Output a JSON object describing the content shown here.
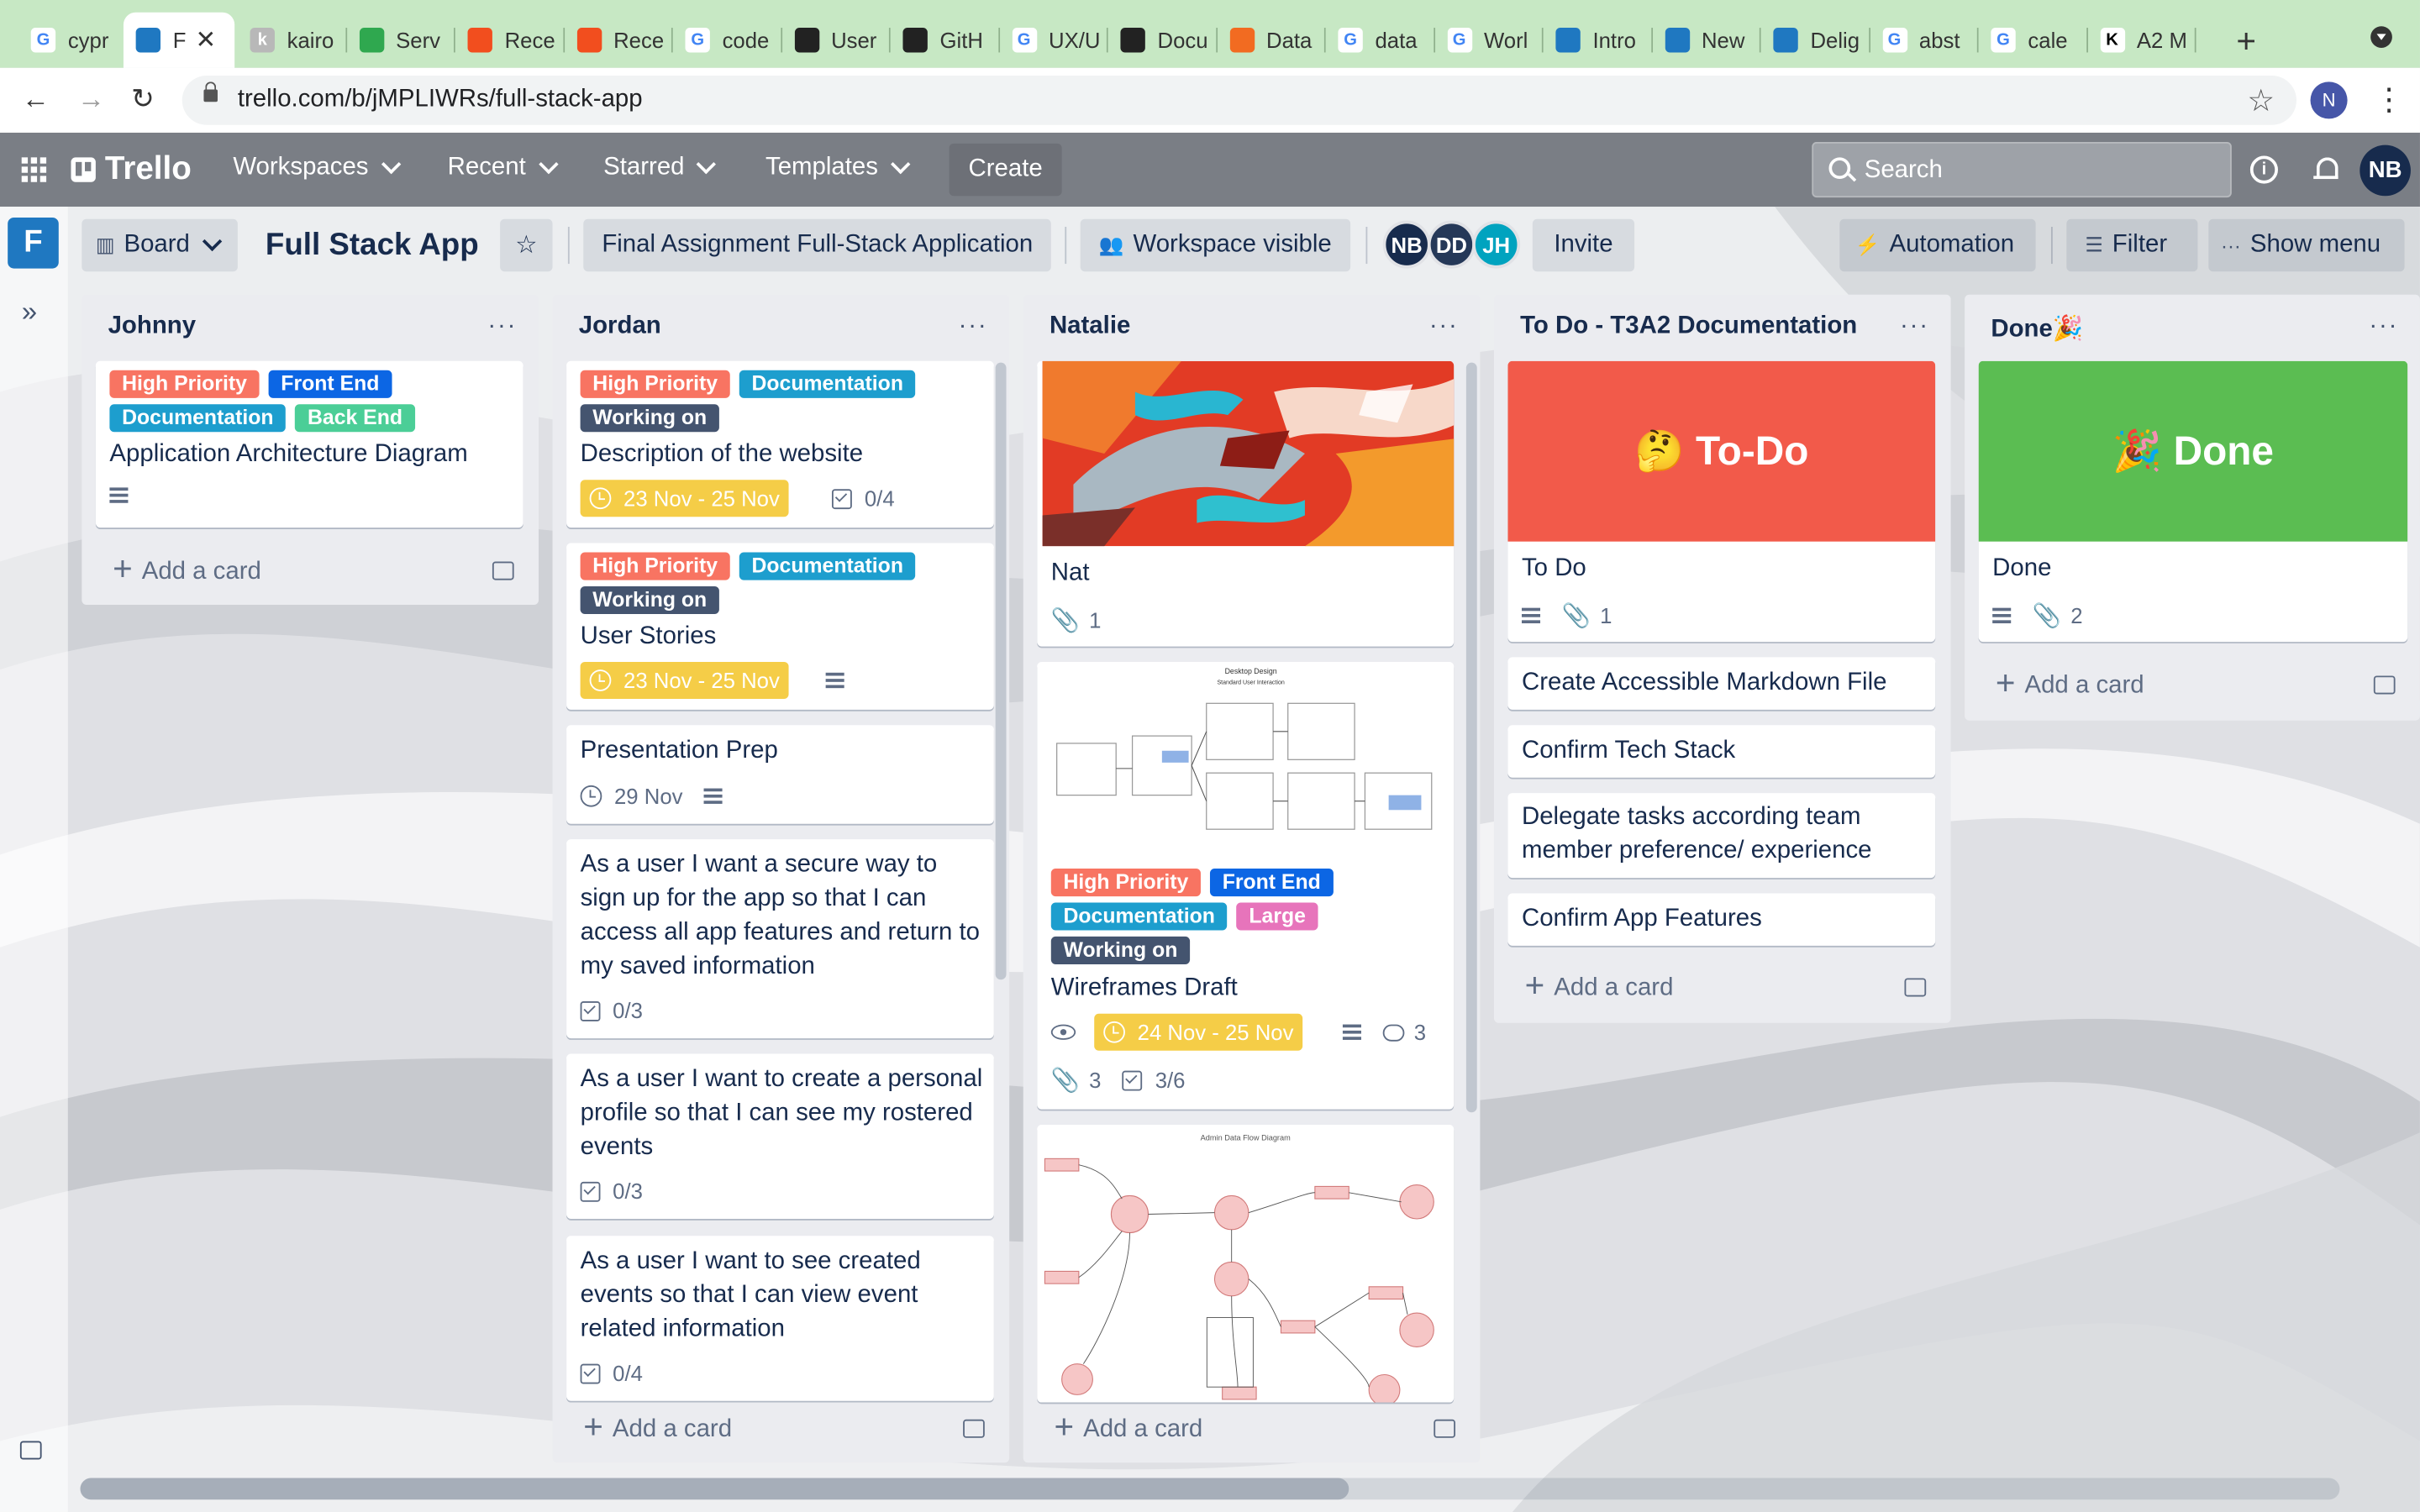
{
  "browser": {
    "tabs": [
      {
        "title": "cypr",
        "favicon": "google"
      },
      {
        "title": "F",
        "favicon": "trello",
        "active": true
      },
      {
        "title": "kairo",
        "favicon": "k"
      },
      {
        "title": "Serv",
        "favicon": "green"
      },
      {
        "title": "Rece",
        "favicon": "figma"
      },
      {
        "title": "Rece",
        "favicon": "figma"
      },
      {
        "title": "code",
        "favicon": "google"
      },
      {
        "title": "User",
        "favicon": "dark"
      },
      {
        "title": "GitH",
        "favicon": "github"
      },
      {
        "title": "UX/U",
        "favicon": "google"
      },
      {
        "title": "Docu",
        "favicon": "dark"
      },
      {
        "title": "Data",
        "favicon": "orange"
      },
      {
        "title": "data",
        "favicon": "google"
      },
      {
        "title": "Worl",
        "favicon": "google"
      },
      {
        "title": "Intro",
        "favicon": "trello"
      },
      {
        "title": "New",
        "favicon": "trello"
      },
      {
        "title": "Delig",
        "favicon": "trello"
      },
      {
        "title": "abst",
        "favicon": "google"
      },
      {
        "title": "cale",
        "favicon": "google"
      },
      {
        "title": "A2 M",
        "favicon": "k-dark"
      }
    ],
    "close_glyph": "✕",
    "new_tab": "+",
    "url": "trello.com/b/jMPLIWRs/full-stack-app",
    "profile_initial": "N"
  },
  "header": {
    "logo": "Trello",
    "nav": [
      "Workspaces",
      "Recent",
      "Starred",
      "Templates"
    ],
    "create": "Create",
    "search_placeholder": "Search",
    "user_initials": "NB"
  },
  "sidebar": {
    "workspace_initial": "F",
    "expand_glyph": "»"
  },
  "board": {
    "view": "Board",
    "title": "Full Stack App",
    "star": "☆",
    "workspace_name": "Final Assignment Full-Stack Application",
    "visibility": "Workspace visible",
    "members": [
      {
        "initials": "NB",
        "color": "#172b4d"
      },
      {
        "initials": "DD",
        "color": "#253858"
      },
      {
        "initials": "JH",
        "color": "#00a3bf"
      }
    ],
    "invite": "Invite",
    "automation": "Automation",
    "filter": "Filter",
    "show_menu": "Show menu"
  },
  "label_colors": {
    "High Priority": "#f87462",
    "Front End": "#0c66e4",
    "Documentation": "#1d9ece",
    "Back End": "#4bce97",
    "Working on": "#44546f",
    "Large": "#e774bb"
  },
  "lists": [
    {
      "title": "Johnny",
      "add_card": "Add a card",
      "cards": [
        {
          "labels": [
            "High Priority",
            "Front End",
            "Documentation",
            "Back End"
          ],
          "title": "Application Architecture Diagram",
          "description": true
        }
      ]
    },
    {
      "title": "Jordan",
      "add_card": "Add a card",
      "cards": [
        {
          "labels": [
            "High Priority",
            "Documentation",
            "Working on"
          ],
          "title": "Description of the website",
          "due": "23 Nov - 25 Nov",
          "checklist": "0/4"
        },
        {
          "labels": [
            "High Priority",
            "Documentation",
            "Working on"
          ],
          "title": "User Stories",
          "due": "23 Nov - 25 Nov",
          "description": true
        },
        {
          "title": "Presentation Prep",
          "date": "29 Nov",
          "description": true
        },
        {
          "title": "As a user I want a secure way to sign up for the app so that I can access all app features and return to my saved information",
          "checklist": "0/3"
        },
        {
          "title": "As a user I want to create a personal profile so that I can see my rostered events",
          "checklist": "0/3"
        },
        {
          "title": "As a user I want to see created events so that I can view event related information",
          "checklist": "0/4"
        }
      ]
    },
    {
      "title": "Natalie",
      "add_card": "Add a card",
      "cards": [
        {
          "cover": "painting",
          "title": "Nat",
          "attachments": "1"
        },
        {
          "cover": "wireframe",
          "labels": [
            "High Priority",
            "Front End",
            "Documentation",
            "Large",
            "Working on"
          ],
          "title": "Wireframes Draft",
          "due": "24 Nov - 25 Nov",
          "comments": "3",
          "attachments": "3",
          "checklist": "3/6"
        },
        {
          "cover": "flowchart"
        }
      ]
    },
    {
      "title": "To Do - T3A2 Documentation",
      "add_card": "Add a card",
      "cards": [
        {
          "cover_text": "🤔 To-Do",
          "cover_color": "#f25a4a",
          "title": "To Do",
          "attachments": "1",
          "description": true
        },
        {
          "title": "Create Accessible Markdown File"
        },
        {
          "title": "Confirm Tech Stack"
        },
        {
          "title": "Delegate tasks according team member preference/ experience"
        },
        {
          "title": "Confirm App Features"
        }
      ]
    },
    {
      "title": "Done🎉",
      "add_card": "Add a card",
      "cards": [
        {
          "cover_text": "🎉 Done",
          "cover_color": "#5bbd52",
          "title": "Done",
          "attachments": "2",
          "description": true
        }
      ]
    }
  ]
}
